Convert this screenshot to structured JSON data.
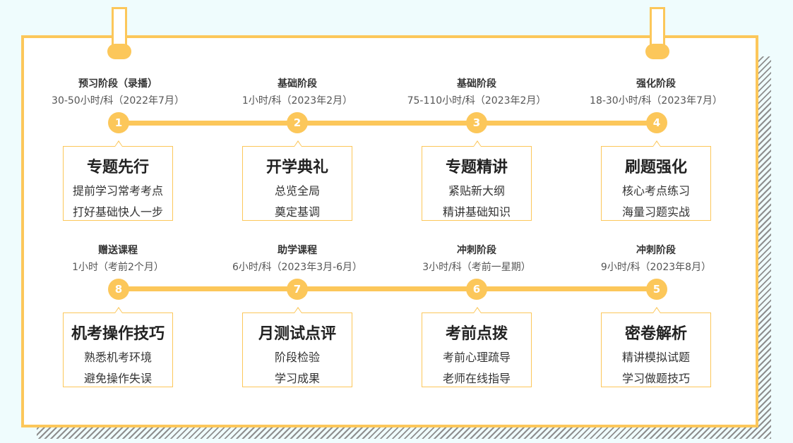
{
  "stages": [
    {
      "num": "1",
      "name": "预习阶段（录播）",
      "detail": "30-50小时/科（2022年7月）",
      "title": "专题先行",
      "line1": "提前学习常考考点",
      "line2": "打好基础快人一步"
    },
    {
      "num": "2",
      "name": "基础阶段",
      "detail": "1小时/科（2023年2月）",
      "title": "开学典礼",
      "line1": "总览全局",
      "line2": "奠定基调"
    },
    {
      "num": "3",
      "name": "基础阶段",
      "detail": "75-110小时/科（2023年2月）",
      "title": "专题精讲",
      "line1": "紧贴新大纲",
      "line2": "精讲基础知识"
    },
    {
      "num": "4",
      "name": "强化阶段",
      "detail": "18-30小时/科（2023年7月）",
      "title": "刷题强化",
      "line1": "核心考点练习",
      "line2": "海量习题实战"
    },
    {
      "num": "8",
      "name": "赠送课程",
      "detail": "1小时（考前2个月）",
      "title": "机考操作技巧",
      "line1": "熟悉机考环境",
      "line2": "避免操作失误"
    },
    {
      "num": "7",
      "name": "助学课程",
      "detail": "6小时/科（2023年3月-6月）",
      "title": "月测试点评",
      "line1": "阶段检验",
      "line2": "学习成果"
    },
    {
      "num": "6",
      "name": "冲刺阶段",
      "detail": "3小时/科（考前一星期）",
      "title": "考前点拨",
      "line1": "考前心理疏导",
      "line2": "老师在线指导"
    },
    {
      "num": "5",
      "name": "冲刺阶段",
      "detail": "9小时/科（2023年8月）",
      "title": "密卷解析",
      "line1": "精讲模拟试题",
      "line2": "学习做题技巧"
    }
  ],
  "colors": {
    "accent": "#fcc75a",
    "background": "#effcfd",
    "text": "#333333"
  }
}
